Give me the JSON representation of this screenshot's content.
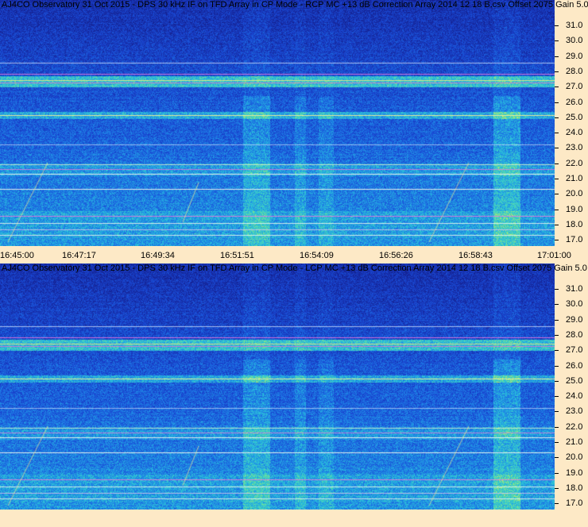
{
  "panels": [
    {
      "id": "rcp",
      "caption": "AJ4CO Observatory 31 Oct 2015 - DPS 30 kHz IF on TFD Array in CP Mode - RCP  MC +13 dB  Correction Array 2014 12 18 B.csv  Offset 2075  Gain 5.0",
      "freq_labels": [
        "31.0",
        "30.0",
        "29.0",
        "28.0",
        "27.0",
        "26.0",
        "25.0",
        "24.0",
        "23.0",
        "22.0",
        "21.0",
        "20.0",
        "19.0",
        "18.0",
        "17.0"
      ],
      "time_labels": [
        "16:45:00",
        "16:47:17",
        "16:49:34",
        "16:51:51",
        "16:54:09",
        "16:56:26",
        "16:58:43",
        "17:01:00"
      ]
    },
    {
      "id": "lcp",
      "caption": "AJ4CO Observatory 31 Oct 2015 - DPS 30 kHz IF on TFD Array in CP Mode - LCP  MC +13 dB  Correction Array 2014 12 18 B.csv  Offset 2075  Gain 5.0",
      "freq_labels": [
        "31.0",
        "30.0",
        "29.0",
        "28.0",
        "27.0",
        "26.0",
        "25.0",
        "24.0",
        "23.0",
        "22.0",
        "21.0",
        "20.0",
        "19.0",
        "18.0",
        "17.0"
      ],
      "time_labels": []
    }
  ],
  "colors": {
    "background": "#fde9c6",
    "spectro_low": "#1a2fa0",
    "spectro_mid": "#2aa0e0",
    "spectro_high": "#e8f060"
  }
}
